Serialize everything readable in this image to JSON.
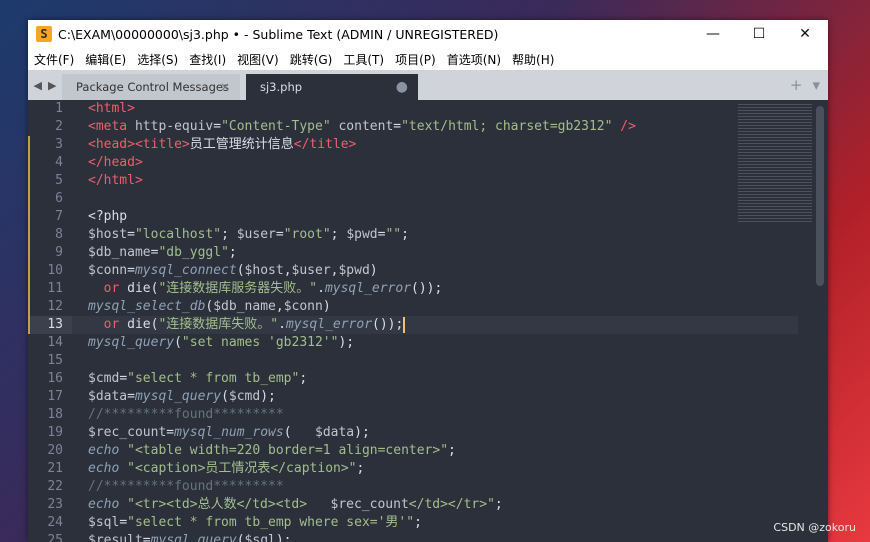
{
  "window": {
    "title": "C:\\EXAM\\00000000\\sj3.php • - Sublime Text (ADMIN / UNREGISTERED)",
    "app_icon_glyph": "S",
    "controls": {
      "minimize": "—",
      "maximize": "☐",
      "close": "✕"
    }
  },
  "menu": [
    "文件(F)",
    "编辑(E)",
    "选择(S)",
    "查找(I)",
    "视图(V)",
    "跳转(G)",
    "工具(T)",
    "项目(P)",
    "首选项(N)",
    "帮助(H)"
  ],
  "tabs": {
    "nav_left": "◀",
    "nav_right": "▶",
    "items": [
      {
        "label": "Package Control Messages",
        "close": "×",
        "active": false
      },
      {
        "label": "sj3.php",
        "close": "●",
        "active": true
      }
    ],
    "add": "+",
    "menu": "▾"
  },
  "editor": {
    "current_line": 13,
    "line_numbers": [
      "1",
      "2",
      "3",
      "4",
      "5",
      "6",
      "7",
      "8",
      "9",
      "10",
      "11",
      "12",
      "13",
      "14",
      "15",
      "16",
      "17",
      "18",
      "19",
      "20",
      "21",
      "22",
      "23",
      "24",
      "25"
    ],
    "lines": [
      [
        {
          "t": "<html>",
          "c": "tag"
        }
      ],
      [
        {
          "t": "<meta ",
          "c": "tag"
        },
        {
          "t": "http-equiv",
          "c": "attr"
        },
        {
          "t": "=",
          "c": "op"
        },
        {
          "t": "\"Content-Type\"",
          "c": "str"
        },
        {
          "t": " content",
          "c": "attr"
        },
        {
          "t": "=",
          "c": "op"
        },
        {
          "t": "\"text/html; charset=gb2312\"",
          "c": "str"
        },
        {
          "t": " />",
          "c": "tag"
        }
      ],
      [
        {
          "t": "<head><title>",
          "c": "tag"
        },
        {
          "t": "员工管理统计信息",
          "c": "op"
        },
        {
          "t": "</title>",
          "c": "tag"
        }
      ],
      [
        {
          "t": "</head>",
          "c": "tag"
        }
      ],
      [
        {
          "t": "</html>",
          "c": "tag"
        }
      ],
      [],
      [
        {
          "t": "<?php",
          "c": "op"
        }
      ],
      [
        {
          "t": "$host",
          "c": "var"
        },
        {
          "t": "=",
          "c": "op"
        },
        {
          "t": "\"localhost\"",
          "c": "str"
        },
        {
          "t": "; ",
          "c": "op"
        },
        {
          "t": "$user",
          "c": "var"
        },
        {
          "t": "=",
          "c": "op"
        },
        {
          "t": "\"root\"",
          "c": "str"
        },
        {
          "t": "; ",
          "c": "op"
        },
        {
          "t": "$pwd",
          "c": "var"
        },
        {
          "t": "=",
          "c": "op"
        },
        {
          "t": "\"\"",
          "c": "str"
        },
        {
          "t": ";",
          "c": "op"
        }
      ],
      [
        {
          "t": "$db_name",
          "c": "var"
        },
        {
          "t": "=",
          "c": "op"
        },
        {
          "t": "\"db_yggl\"",
          "c": "str"
        },
        {
          "t": ";",
          "c": "op"
        }
      ],
      [
        {
          "t": "$conn",
          "c": "var"
        },
        {
          "t": "=",
          "c": "op"
        },
        {
          "t": "mysql_connect",
          "c": "fn"
        },
        {
          "t": "(",
          "c": "op"
        },
        {
          "t": "$host",
          "c": "var"
        },
        {
          "t": ",",
          "c": "op"
        },
        {
          "t": "$user",
          "c": "var"
        },
        {
          "t": ",",
          "c": "op"
        },
        {
          "t": "$pwd",
          "c": "var"
        },
        {
          "t": ")",
          "c": "op"
        }
      ],
      [
        {
          "t": "  or ",
          "c": "tag"
        },
        {
          "t": "die(",
          "c": "op"
        },
        {
          "t": "\"连接数据库服务器失败。\"",
          "c": "str"
        },
        {
          "t": ".",
          "c": "op"
        },
        {
          "t": "mysql_error",
          "c": "fn"
        },
        {
          "t": "());",
          "c": "op"
        }
      ],
      [
        {
          "t": "mysql_select_db",
          "c": "fn"
        },
        {
          "t": "(",
          "c": "op"
        },
        {
          "t": "$db_name",
          "c": "var"
        },
        {
          "t": ",",
          "c": "op"
        },
        {
          "t": "$conn",
          "c": "var"
        },
        {
          "t": ")",
          "c": "op"
        }
      ],
      [
        {
          "t": "  or ",
          "c": "tag"
        },
        {
          "t": "die(",
          "c": "op"
        },
        {
          "t": "\"连接数据库失败。\"",
          "c": "str"
        },
        {
          "t": ".",
          "c": "op"
        },
        {
          "t": "mysql_error",
          "c": "fn"
        },
        {
          "t": "());",
          "c": "op"
        }
      ],
      [
        {
          "t": "mysql_query",
          "c": "fn"
        },
        {
          "t": "(",
          "c": "op"
        },
        {
          "t": "\"set names 'gb2312'\"",
          "c": "str"
        },
        {
          "t": ");",
          "c": "op"
        }
      ],
      [],
      [
        {
          "t": "$cmd",
          "c": "var"
        },
        {
          "t": "=",
          "c": "op"
        },
        {
          "t": "\"select * from tb_emp\"",
          "c": "str"
        },
        {
          "t": ";",
          "c": "op"
        }
      ],
      [
        {
          "t": "$data",
          "c": "var"
        },
        {
          "t": "=",
          "c": "op"
        },
        {
          "t": "mysql_query",
          "c": "fn"
        },
        {
          "t": "(",
          "c": "op"
        },
        {
          "t": "$cmd",
          "c": "var"
        },
        {
          "t": ");",
          "c": "op"
        }
      ],
      [
        {
          "t": "//*********found*********",
          "c": "cm"
        }
      ],
      [
        {
          "t": "$rec_count",
          "c": "var"
        },
        {
          "t": "=",
          "c": "op"
        },
        {
          "t": "mysql_num_rows",
          "c": "fn"
        },
        {
          "t": "(   ",
          "c": "op"
        },
        {
          "t": "$data",
          "c": "var"
        },
        {
          "t": ");",
          "c": "op"
        }
      ],
      [
        {
          "t": "echo ",
          "c": "fn"
        },
        {
          "t": "\"<table width=220 border=1 align=center>\"",
          "c": "str"
        },
        {
          "t": ";",
          "c": "op"
        }
      ],
      [
        {
          "t": "echo ",
          "c": "fn"
        },
        {
          "t": "\"<caption>员工情况表</caption>\"",
          "c": "str"
        },
        {
          "t": ";",
          "c": "op"
        }
      ],
      [
        {
          "t": "//*********found*********",
          "c": "cm"
        }
      ],
      [
        {
          "t": "echo ",
          "c": "fn"
        },
        {
          "t": "\"<tr><td>总人数</td><td>   ",
          "c": "str"
        },
        {
          "t": "$rec_count",
          "c": "var"
        },
        {
          "t": "</td></tr>\"",
          "c": "str"
        },
        {
          "t": ";",
          "c": "op"
        }
      ],
      [
        {
          "t": "$sql",
          "c": "var"
        },
        {
          "t": "=",
          "c": "op"
        },
        {
          "t": "\"select * from tb_emp where sex='男'\"",
          "c": "str"
        },
        {
          "t": ";",
          "c": "op"
        }
      ],
      [
        {
          "t": "$result",
          "c": "var"
        },
        {
          "t": "=",
          "c": "op"
        },
        {
          "t": "mysql_query",
          "c": "fn"
        },
        {
          "t": "(",
          "c": "op"
        },
        {
          "t": "$sql",
          "c": "var"
        },
        {
          "t": ");",
          "c": "op"
        }
      ]
    ]
  },
  "watermark": "CSDN @zokoru"
}
